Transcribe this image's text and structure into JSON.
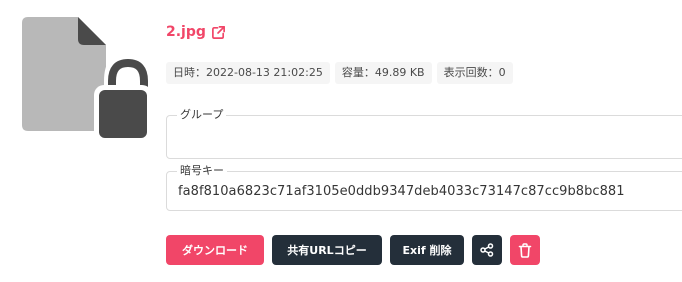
{
  "file": {
    "name": "2.jpg"
  },
  "tags": [
    {
      "label": "日時：2022-08-13 21:02:25"
    },
    {
      "label": "容量：49.89 KB"
    },
    {
      "label": "表示回数：0"
    }
  ],
  "group": {
    "legend": "グループ",
    "value": ""
  },
  "key": {
    "legend": "暗号キー",
    "value": "fa8f810a6823c71af3105e0ddb9347deb4033c73147c87cc9b8bc881"
  },
  "buttons": {
    "download": "ダウンロード",
    "copy_url": "共有URLコピー",
    "exif_delete": "Exif 削除"
  },
  "icons": {
    "file": "locked-file-icon",
    "external": "external-link-icon",
    "share": "share-icon",
    "trash": "trash-icon"
  },
  "colors": {
    "accent": "#f14668",
    "dark_button": "#242f3a",
    "tag_bg": "#f5f5f5"
  }
}
